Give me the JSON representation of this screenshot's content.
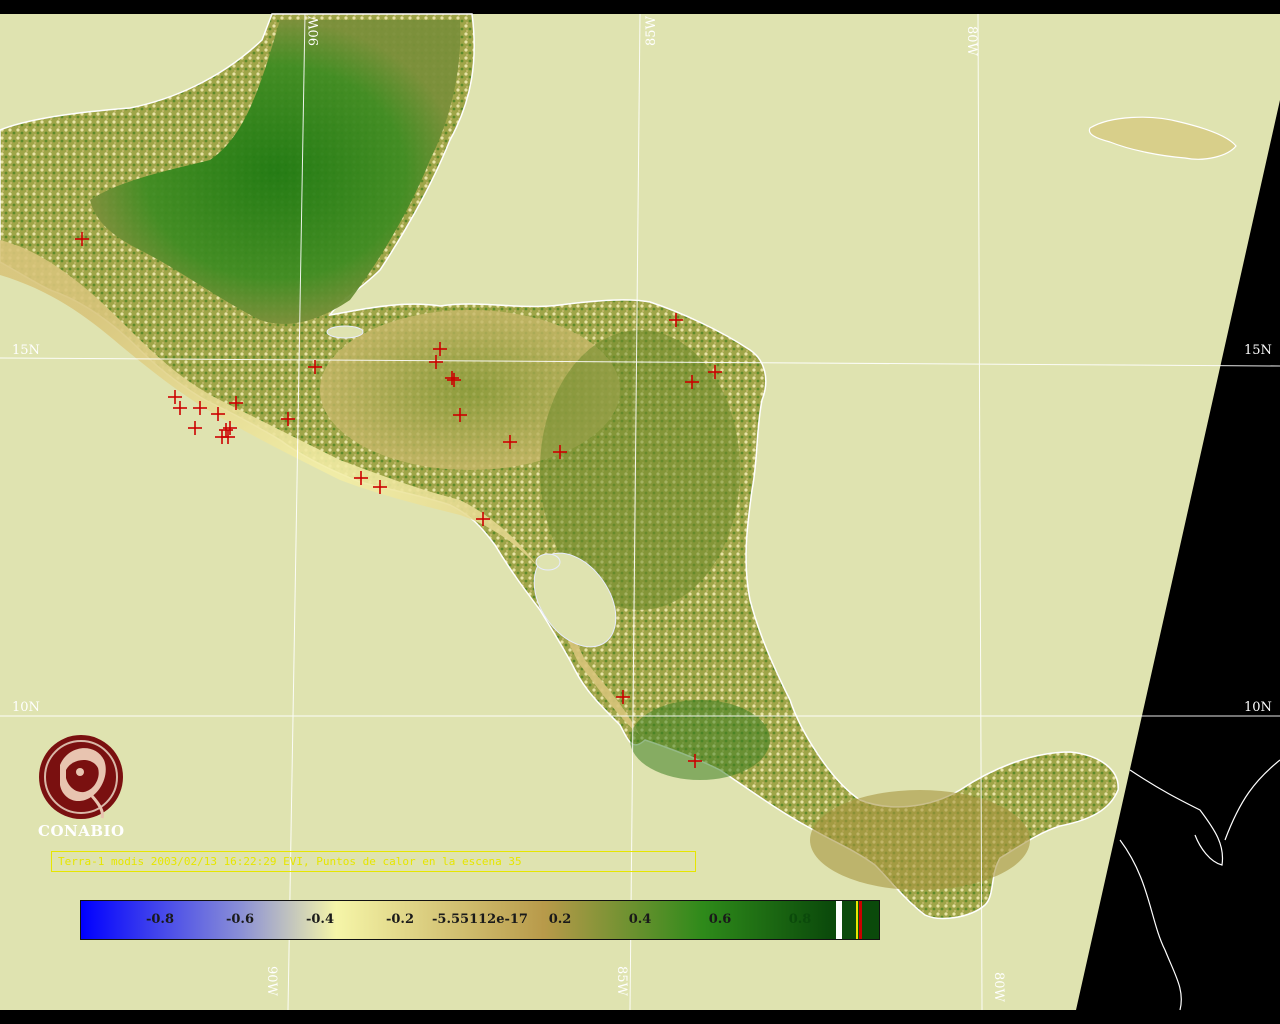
{
  "map": {
    "background_land_color": "#dfe3b0",
    "outside_swath_color": "#000000",
    "coastline_color": "#ffffff",
    "fire_marker_color": "#cc0000",
    "grid_labels": {
      "lat_15_left": "15N",
      "lat_15_right": "15N",
      "lat_10_left": "10N",
      "lat_10_right": "10N",
      "lon_90_top": "90W",
      "lon_85_top": "85W",
      "lon_80_top": "80W",
      "lon_90_bottom": "90W",
      "lon_85_bottom": "85W",
      "lon_80_bottom": "80W"
    },
    "fire_points_count": 28
  },
  "logo": {
    "name": "CONABIO"
  },
  "caption": "Terra-1 modis 2003/02/13 16:22:29 EVI, Puntos de calor en la escena 35",
  "colorbar": {
    "labels": [
      "-0.8",
      "-0.6",
      "-0.4",
      "-0.2",
      "-5.55112e-17",
      "0.2",
      "0.4",
      "0.6",
      "0.8"
    ],
    "colors": [
      "#0000ff",
      "#8a8fd6",
      "#f5f5a8",
      "#b89a4a",
      "#2e8a1a",
      "#0b4a0b"
    ]
  }
}
